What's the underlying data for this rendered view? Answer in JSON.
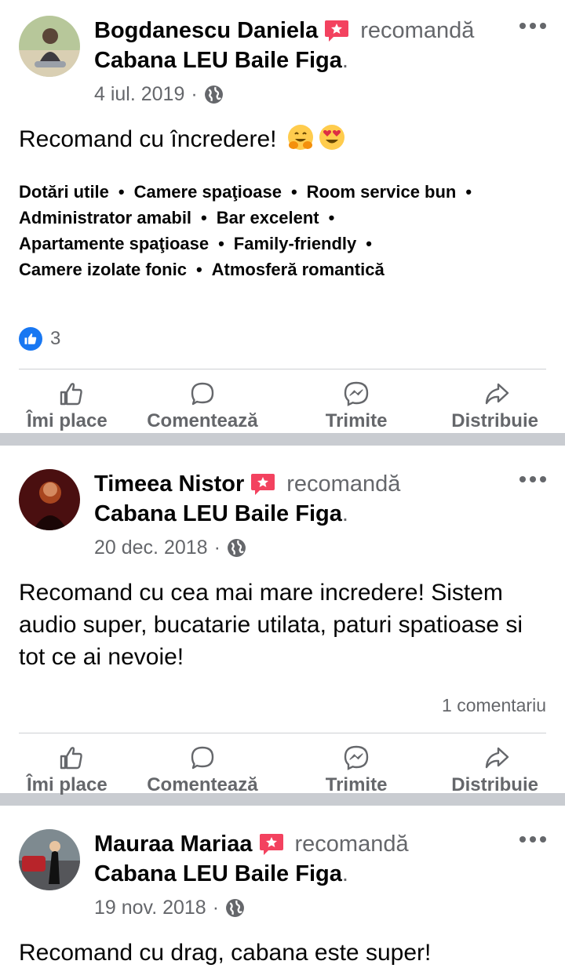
{
  "posts": [
    {
      "author": "Bogdanescu Daniela",
      "verb": "recomandă",
      "page": "Cabana LEU Baile Figa",
      "date": "4 iul. 2019",
      "text": "Recomand cu încredere!",
      "emojis": [
        "hugging-face-emoji",
        "heart-eyes-emoji"
      ],
      "tags": [
        "Dotări utile",
        "Camere spaţioase",
        "Room service bun",
        "Administrator amabil",
        "Bar excelent",
        "Apartamente spaţioase",
        "Family-friendly",
        "Camere izolate fonic",
        "Atmosferă romantică"
      ],
      "reaction_count": "3"
    },
    {
      "author": "Timeea Nistor",
      "verb": "recomandă",
      "page": "Cabana LEU Baile Figa",
      "date": "20 dec. 2018",
      "text": "Recomand cu cea mai mare incredere! Sistem audio super, bucatarie utilata, paturi spatioase si tot ce ai nevoie!",
      "comment_count": "1 comentariu"
    },
    {
      "author": "Mauraa Mariaa",
      "verb": "recomandă",
      "page": "Cabana LEU Baile Figa",
      "date": "19 nov. 2018",
      "text": "Recomand cu drag, cabana este super!"
    }
  ],
  "actions": {
    "like": "Îmi place",
    "comment": "Comentează",
    "send": "Trimite",
    "share": "Distribuie"
  },
  "colors": {
    "recommend_badge": "#f3425f",
    "like_blue": "#1877f2",
    "secondary_text": "#65676b",
    "divider": "#c9ccd1"
  }
}
